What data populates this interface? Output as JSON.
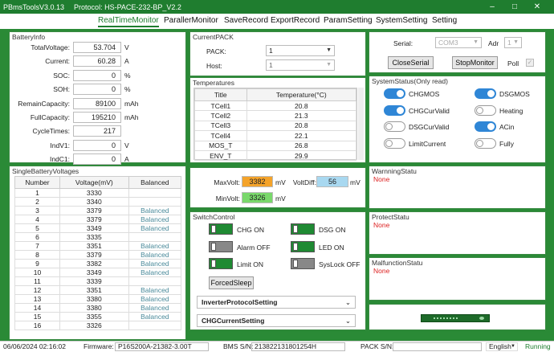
{
  "window": {
    "title": "PBmsToolsV3.0.13",
    "protocol": "Protocol: HS-PACE-232-BP_V2.2"
  },
  "menu": [
    "RealTimeMonitor",
    "ParallerMonitor",
    "SaveRecord",
    "ExportRecord",
    "ParamSetting",
    "SystemSetting",
    "Setting"
  ],
  "battery_info": {
    "title": "BatteryInfo",
    "fields": [
      {
        "label": "TotalVoltage:",
        "value": "53.704",
        "unit": "V"
      },
      {
        "label": "Current:",
        "value": "60.28",
        "unit": "A"
      },
      {
        "label": "SOC:",
        "value": "0",
        "unit": "%"
      },
      {
        "label": "SOH:",
        "value": "0",
        "unit": "%"
      },
      {
        "label": "RemainCapacity:",
        "value": "89100",
        "unit": "mAh"
      },
      {
        "label": "FullCapacity:",
        "value": "195210",
        "unit": "mAh"
      },
      {
        "label": "CycleTimes:",
        "value": "217",
        "unit": ""
      },
      {
        "label": "IndV1:",
        "value": "0",
        "unit": "V"
      },
      {
        "label": "IndC1:",
        "value": "0",
        "unit": "A"
      }
    ]
  },
  "current_pack": {
    "title": "CurrentPACK",
    "pack_label": "PACK:",
    "pack_value": "1",
    "host_label": "Host:",
    "host_value": "1"
  },
  "serial": {
    "serial_label": "Serial:",
    "serial_value": "COM3",
    "adr_label": "Adr",
    "adr_value": "1",
    "close_btn": "CloseSerial",
    "stop_btn": "StopMonitor",
    "poll_label": "Poll"
  },
  "temperatures": {
    "title": "Temperatures",
    "headers": [
      "Title",
      "Temperature(°C)"
    ],
    "rows": [
      [
        "TCell1",
        "20.8"
      ],
      [
        "TCell2",
        "21.3"
      ],
      [
        "TCell3",
        "20.8"
      ],
      [
        "TCell4",
        "22.1"
      ],
      [
        "MOS_T",
        "26.8"
      ],
      [
        "ENV_T",
        "29.9"
      ]
    ]
  },
  "system_status": {
    "title": "SystemStatus(Only read)",
    "items": [
      {
        "label": "CHGMOS",
        "on": true
      },
      {
        "label": "DSGMOS",
        "on": true
      },
      {
        "label": "CHGCurValid",
        "on": true
      },
      {
        "label": "Heating",
        "on": false
      },
      {
        "label": "DSGCurValid",
        "on": false
      },
      {
        "label": "ACin",
        "on": true
      },
      {
        "label": "LimitCurrent",
        "on": false
      },
      {
        "label": "Fully",
        "on": false
      }
    ]
  },
  "voltages_panel": {
    "title": "SingleBatteryVoltages",
    "headers": [
      "Number",
      "Voltage(mV)",
      "Balanced"
    ],
    "rows": [
      [
        "1",
        "3330",
        ""
      ],
      [
        "2",
        "3340",
        ""
      ],
      [
        "3",
        "3379",
        "Balanced"
      ],
      [
        "4",
        "3379",
        "Balanced"
      ],
      [
        "5",
        "3349",
        "Balanced"
      ],
      [
        "6",
        "3335",
        ""
      ],
      [
        "7",
        "3351",
        "Balanced"
      ],
      [
        "8",
        "3379",
        "Balanced"
      ],
      [
        "9",
        "3382",
        "Balanced"
      ],
      [
        "10",
        "3349",
        "Balanced"
      ],
      [
        "11",
        "3339",
        ""
      ],
      [
        "12",
        "3351",
        "Balanced"
      ],
      [
        "13",
        "3380",
        "Balanced"
      ],
      [
        "14",
        "3380",
        "Balanced"
      ],
      [
        "15",
        "3355",
        "Balanced"
      ],
      [
        "16",
        "3326",
        ""
      ]
    ]
  },
  "volt_summary": {
    "max_label": "MaxVolt:",
    "max_value": "3382",
    "diff_label": "VoltDiff:",
    "diff_value": "56",
    "min_label": "MinVolt:",
    "min_value": "3326",
    "unit": "mV",
    "max_color": "#f4a32a",
    "diff_color": "#a8d8f0",
    "min_color": "#79d86b"
  },
  "switch_control": {
    "title": "SwitchControl",
    "items": [
      {
        "label": "CHG ON",
        "on": true
      },
      {
        "label": "DSG ON",
        "on": true
      },
      {
        "label": "Alarm OFF",
        "on": false
      },
      {
        "label": "LED ON",
        "on": true
      },
      {
        "label": "Limit ON",
        "on": true
      },
      {
        "label": "SysLock OFF",
        "on": false
      }
    ],
    "forced_sleep": "ForcedSleep",
    "inverter": "InverterProtocolSetting",
    "chg_current": "CHGCurrentSetting"
  },
  "status_panels": {
    "warning": {
      "title": "WarnningStatu",
      "value": "None"
    },
    "protect": {
      "title": "ProtectStatu",
      "value": "None"
    },
    "malfunction": {
      "title": "MalfunctionStatu",
      "value": "None"
    }
  },
  "statusbar": {
    "datetime": "06/06/2024 02:16:02",
    "firmware_label": "Firmware:",
    "firmware_value": "P16S200A-21382-3.00T",
    "bms_label": "BMS S/N:",
    "bms_value": "213822131801254H",
    "pack_label": "PACK S/N:",
    "pack_value": "",
    "language": "English",
    "state": "Running"
  },
  "colors": {
    "accent": "#1f7d2f",
    "toggle_on": "#2f86d6",
    "none_text": "#dd2222"
  }
}
